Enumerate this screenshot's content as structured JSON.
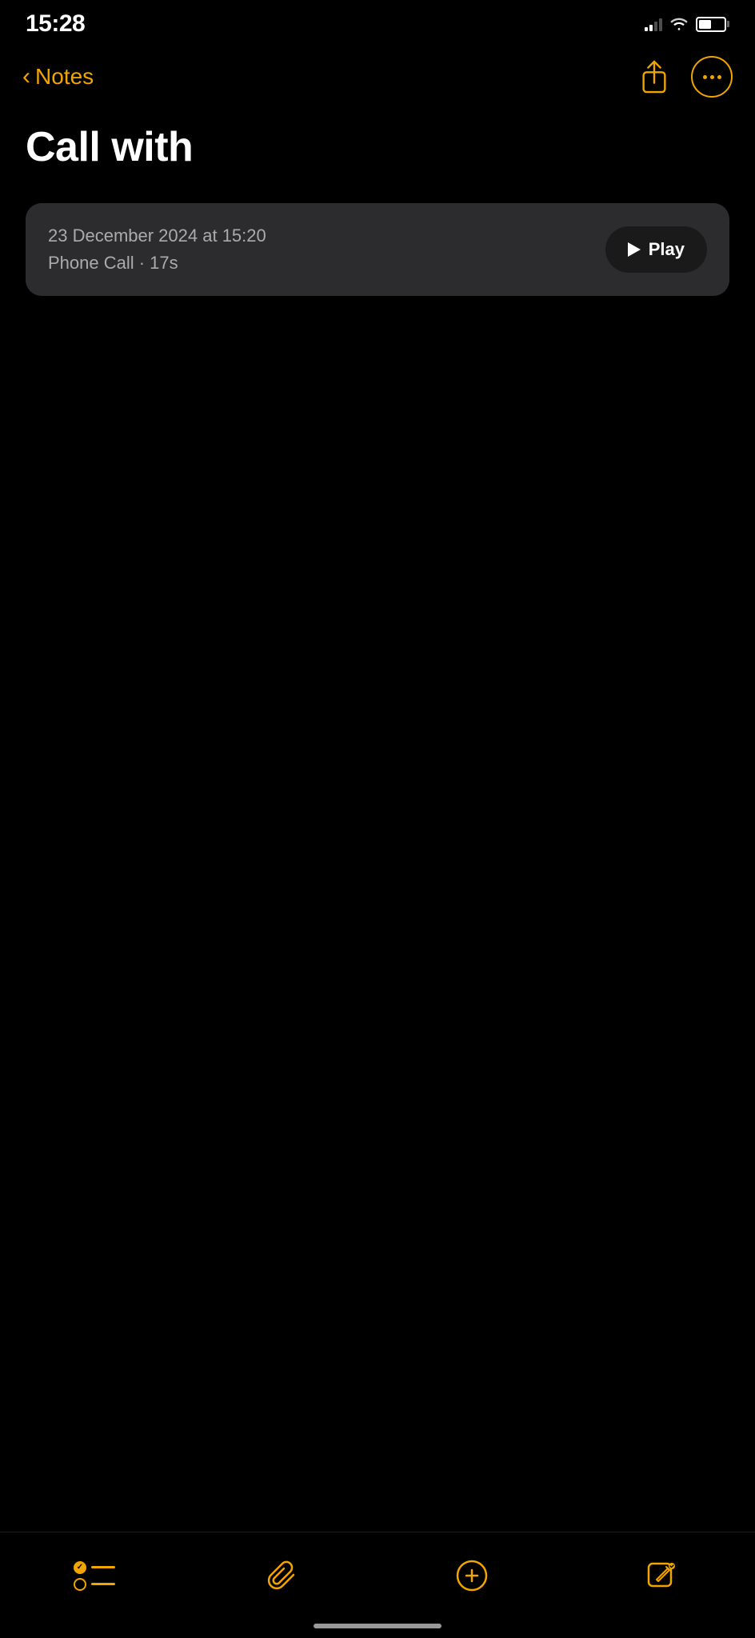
{
  "status_bar": {
    "time": "15:28",
    "signal_bars": 2,
    "battery_level": 50
  },
  "nav": {
    "back_label": "Notes",
    "share_icon": "share-icon",
    "more_icon": "more-icon"
  },
  "note": {
    "title": "Call with"
  },
  "recording": {
    "date": "23 December 2024 at 15:20",
    "meta": "Phone Call · 17s",
    "play_button_label": "Play"
  },
  "toolbar": {
    "checklist_icon": "checklist-icon",
    "attachment_icon": "attachment-icon",
    "compose_icon": "compose-icon",
    "pencil_icon": "pencil-icon"
  }
}
